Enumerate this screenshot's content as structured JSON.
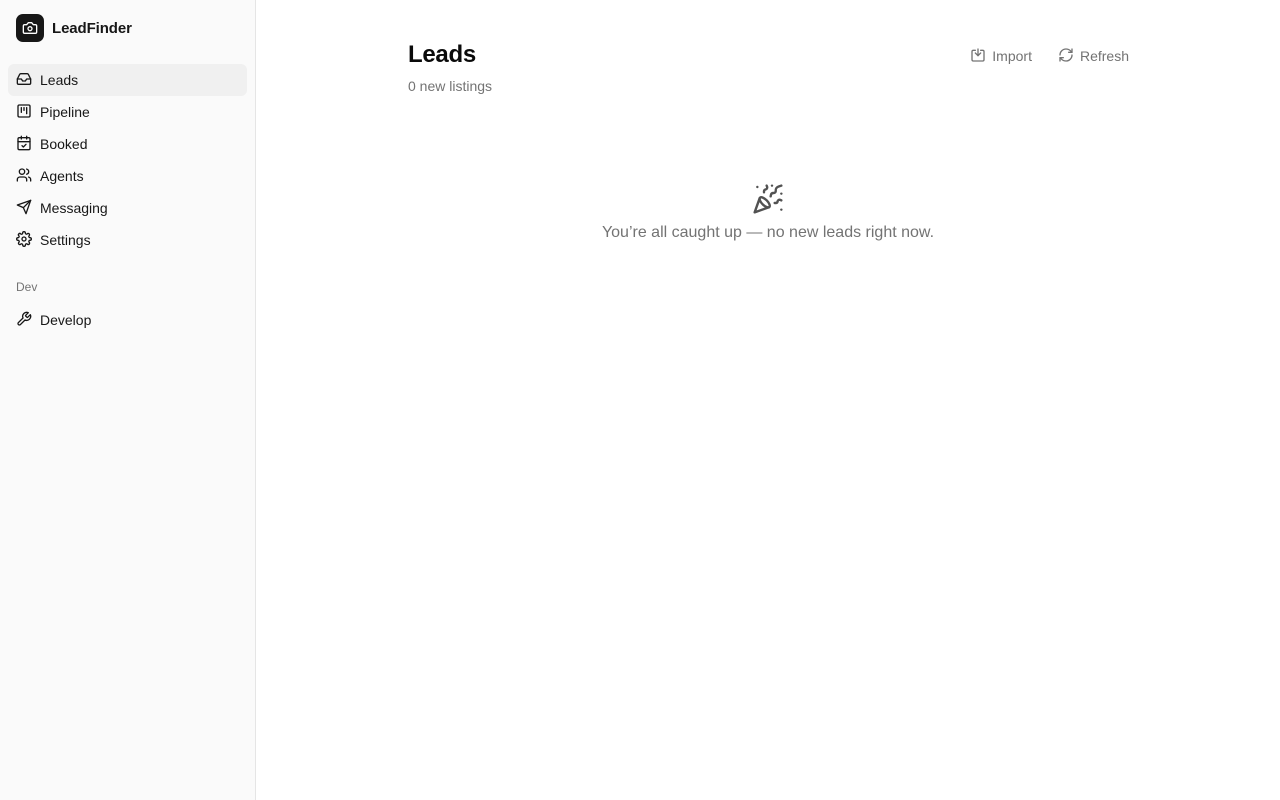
{
  "app": {
    "name": "LeadFinder",
    "logo_icon": "camera-icon"
  },
  "sidebar": {
    "items": [
      {
        "label": "Leads",
        "icon": "inbox-icon",
        "active": true
      },
      {
        "label": "Pipeline",
        "icon": "kanban-icon"
      },
      {
        "label": "Booked",
        "icon": "calendar-check-icon"
      },
      {
        "label": "Agents",
        "icon": "users-icon"
      },
      {
        "label": "Messaging",
        "icon": "send-icon"
      },
      {
        "label": "Settings",
        "icon": "gear-icon"
      }
    ],
    "section_label": "Dev",
    "dev_items": [
      {
        "label": "Develop",
        "icon": "wrench-icon"
      }
    ]
  },
  "header": {
    "title": "Leads",
    "subtitle": "0 new listings",
    "import_label": "Import",
    "refresh_label": "Refresh"
  },
  "empty_state": {
    "icon": "party-popper-icon",
    "message": "You’re all caught up — no new leads right now."
  },
  "colors": {
    "text": "#171717",
    "muted": "#737373",
    "sidebar_bg": "#fafafa",
    "active_bg": "#f0f0f0",
    "border": "#e5e5e5"
  }
}
